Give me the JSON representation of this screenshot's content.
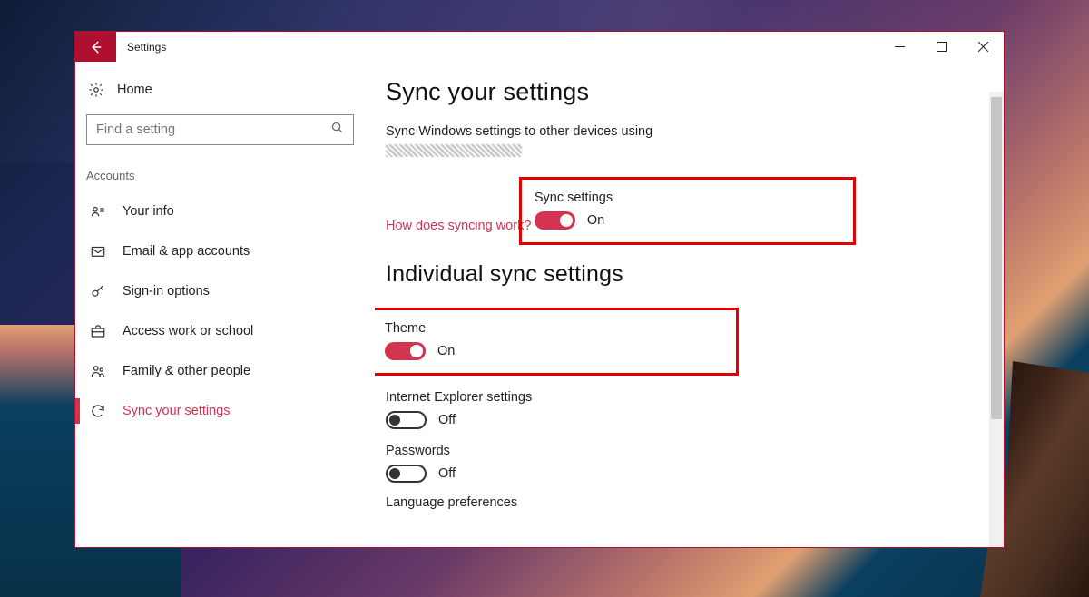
{
  "window": {
    "app_title": "Settings"
  },
  "sidebar": {
    "home_label": "Home",
    "search_placeholder": "Find a setting",
    "category": "Accounts",
    "items": [
      {
        "label": "Your info"
      },
      {
        "label": "Email & app accounts"
      },
      {
        "label": "Sign-in options"
      },
      {
        "label": "Access work or school"
      },
      {
        "label": "Family & other people"
      },
      {
        "label": "Sync your settings"
      }
    ]
  },
  "main": {
    "title": "Sync your settings",
    "description": "Sync Windows settings to other devices using",
    "link": "How does syncing work?",
    "sync_settings": {
      "label": "Sync settings",
      "state": "On"
    },
    "section_title": "Individual sync settings",
    "individual": [
      {
        "label": "Theme",
        "state": "On",
        "on": true,
        "highlighted": true
      },
      {
        "label": "Internet Explorer settings",
        "state": "Off",
        "on": false
      },
      {
        "label": "Passwords",
        "state": "Off",
        "on": false
      }
    ],
    "truncated_label": "Language preferences"
  },
  "colors": {
    "accent": "#d43350"
  }
}
